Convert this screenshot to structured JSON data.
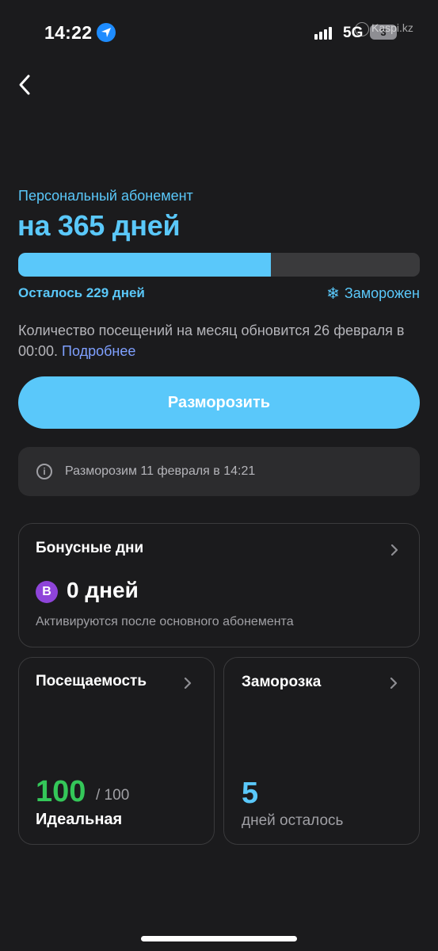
{
  "status_bar": {
    "time": "14:22",
    "network": "5G",
    "battery": "3",
    "watermark": "Kaspi.kz"
  },
  "subscription": {
    "label": "Персональный абонемент",
    "title": "на 365 дней",
    "progress_fraction": 0.63,
    "remaining": "Осталось 229 дней",
    "status": "Заморожен",
    "visits_info": "Количество посещений на месяц обновится 26 февраля в 00:00. ",
    "more_link": "Подробнее"
  },
  "unfreeze_button": "Разморозить",
  "info_box": {
    "text": "Разморозим 11 февраля в 14:21"
  },
  "bonus": {
    "title": "Бонусные дни",
    "badge": "B",
    "value": "0 дней",
    "note": "Активируются после основного абонемента"
  },
  "attendance": {
    "title": "Посещаемость",
    "value": "100",
    "total": "/ 100",
    "label": "Идеальная"
  },
  "freeze": {
    "title": "Заморозка",
    "value": "5",
    "label": "дней осталось"
  },
  "colors": {
    "accent": "#5ac8fa",
    "success": "#34c759",
    "link": "#7fa0ff",
    "badge": "#8e44d9",
    "background": "#1b1b1d"
  }
}
